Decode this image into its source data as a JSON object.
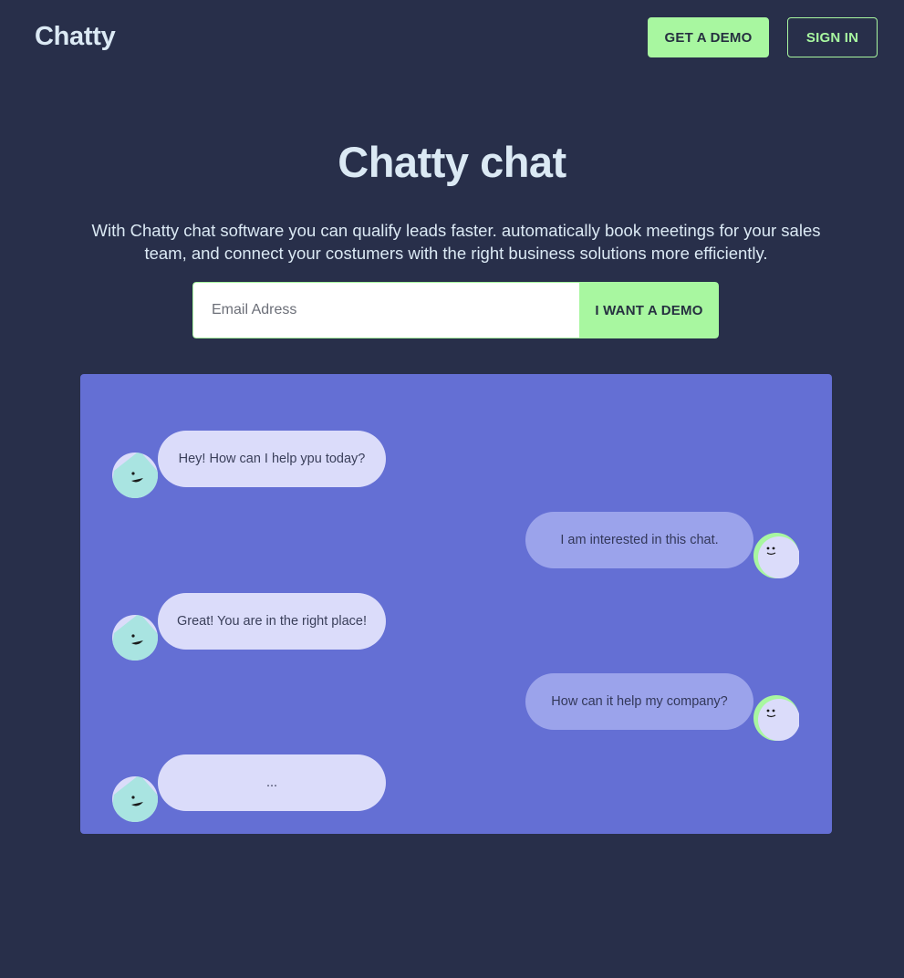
{
  "header": {
    "logo": "Chatty",
    "demo_button": "GET A DEMO",
    "signin_button": "SIGN IN"
  },
  "hero": {
    "title": "Chatty chat",
    "subtitle_line1": "With Chatty chat software you can qualify leads faster. automatically book meetings for your sales",
    "subtitle_line2": "team, and connect your costumers with the right business solutions more efficiently.",
    "email_placeholder": "Email Adress",
    "submit_label": "I WANT A DEMO"
  },
  "chat": {
    "messages": [
      {
        "side": "bot",
        "text": "Hey! How can I help ypu today?"
      },
      {
        "side": "user",
        "text": "I am interested in this chat."
      },
      {
        "side": "bot",
        "text": "Great! You are in the right place!"
      },
      {
        "side": "user",
        "text": "How can it help my company?"
      },
      {
        "side": "bot",
        "text": "..."
      }
    ]
  },
  "colors": {
    "background": "#282f4a",
    "accent": "#a8f7a0",
    "panel": "#646fd4",
    "bot_bubble": "#dbdcfa",
    "user_bubble": "#9ba3eb"
  }
}
